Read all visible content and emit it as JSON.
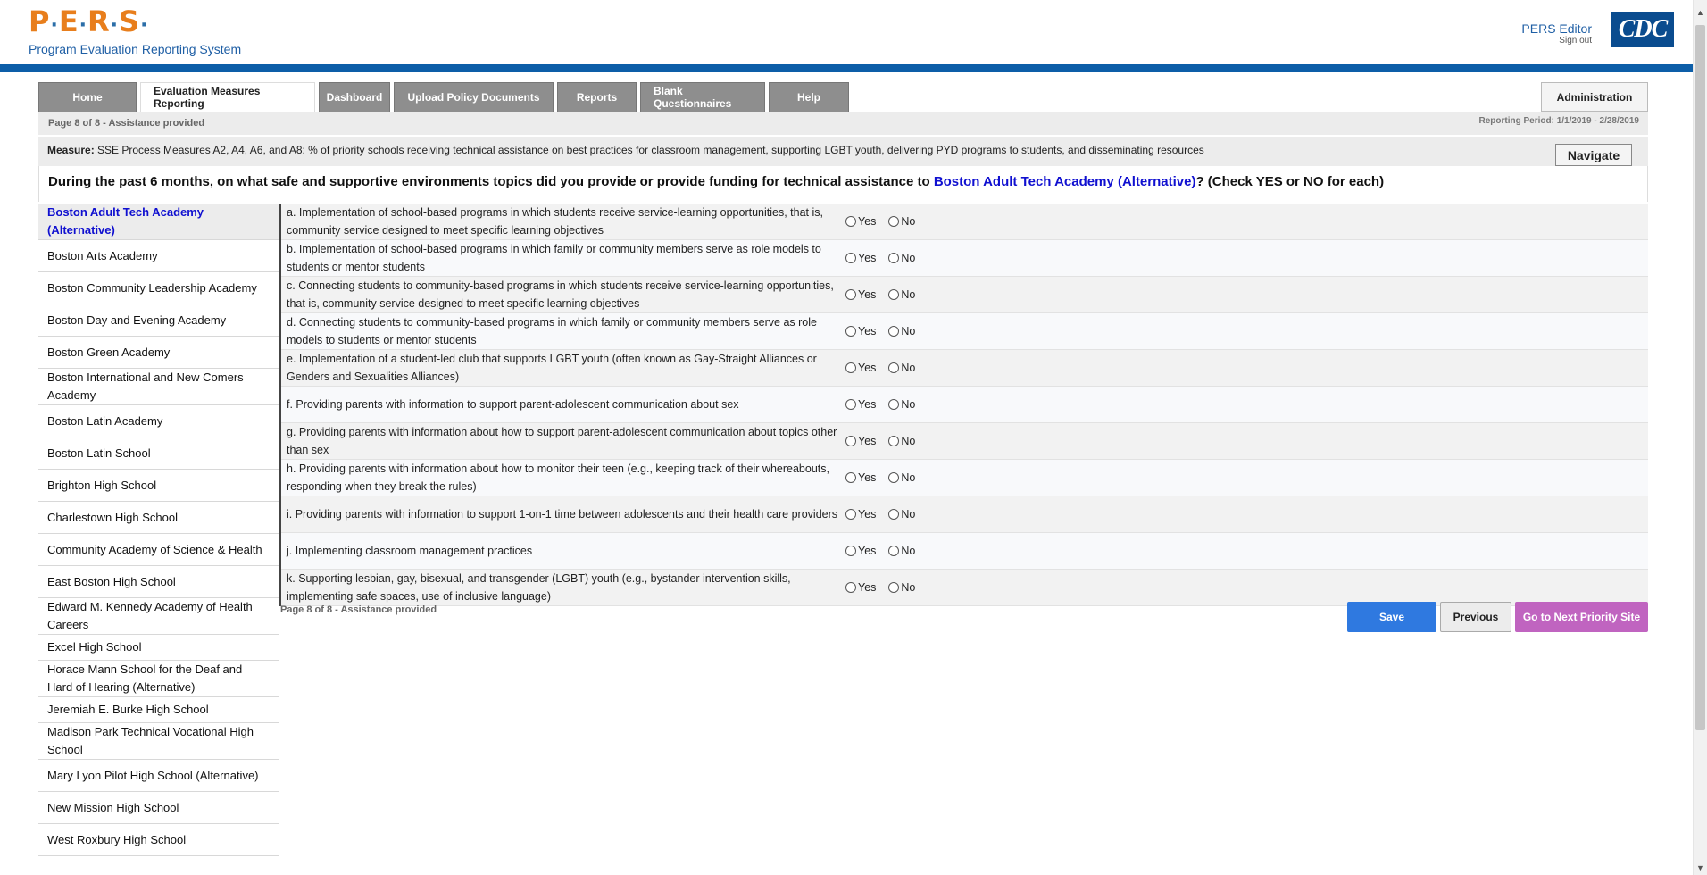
{
  "header": {
    "logo_letters": [
      "P",
      "E",
      "R",
      "S"
    ],
    "logo_dot": "·",
    "subtitle": "Program Evaluation Reporting System",
    "user_name": "PERS Editor",
    "sign_out": "Sign out",
    "cdc_logo": "CDC"
  },
  "tabs": [
    {
      "label": "Home",
      "active": false
    },
    {
      "label": "Evaluation Measures Reporting",
      "active": true
    },
    {
      "label": "Dashboard",
      "active": false
    },
    {
      "label": "Upload Policy Documents",
      "active": false
    },
    {
      "label": "Reports",
      "active": false
    },
    {
      "label": "Blank Questionnaires",
      "active": false
    },
    {
      "label": "Help",
      "active": false
    }
  ],
  "admin_label": "Administration",
  "page_info": "Page 8 of 8 - Assistance provided",
  "reporting_period": "Reporting Period: 1/1/2019 - 2/28/2019",
  "measure": {
    "label": "Measure:",
    "text": "SSE Process Measures A2, A4, A6, and A8: % of priority schools receiving technical assistance on best practices for classroom management, supporting LGBT youth, delivering PYD programs to students, and disseminating resources"
  },
  "navigate_label": "Navigate",
  "question": {
    "prefix": "During the past 6 months, on what safe and supportive environments topics did you provide or provide funding for technical assistance to ",
    "site": "Boston Adult Tech Academy (Alternative)",
    "suffix": "? (Check YES or NO for each)"
  },
  "sidebar": [
    "Boston Adult Tech Academy (Alternative)",
    "Boston Arts Academy",
    "Boston Community Leadership Academy",
    "Boston Day and Evening Academy",
    "Boston Green Academy",
    "Boston International and New Comers Academy",
    "Boston Latin Academy",
    "Boston Latin School",
    "Brighton High School",
    "Charlestown High School",
    "Community Academy of Science & Health",
    "East Boston High School",
    "Edward M. Kennedy Academy of Health Careers",
    "Excel High School",
    "Horace Mann School for the Deaf and Hard of Hearing (Alternative)",
    "Jeremiah E. Burke High School",
    "Madison Park Technical Vocational High School",
    "Mary Lyon Pilot High School (Alternative)",
    "New Mission High School",
    "West Roxbury High School"
  ],
  "sidebar_active_index": 0,
  "option_yes": "Yes",
  "option_no": "No",
  "questions": [
    "a. Implementation of school-based programs in which students receive service-learning opportunities, that is, community service designed to meet specific learning objectives",
    "b. Implementation of school-based programs in which family or community members serve as role models to students or mentor students",
    "c. Connecting students to community-based programs in which students receive service-learning opportunities, that is, community service designed to meet specific learning objectives",
    "d. Connecting students to community-based programs in which family or community members serve as role models to students or mentor students",
    "e. Implementation of a student-led club that supports LGBT youth (often known as Gay-Straight Alliances or Genders and Sexualities Alliances)",
    "f. Providing parents with information to support parent-adolescent communication about sex",
    "g. Providing parents with information about how to support parent-adolescent communication about topics other than sex",
    "h. Providing parents with information about how to monitor their teen (e.g., keeping track of their whereabouts, responding when they break the rules)",
    "i. Providing parents with information to support 1-on-1 time between adolescents and their health care providers",
    "j. Implementing classroom management practices",
    "k. Supporting lesbian, gay, bisexual, and transgender (LGBT) youth (e.g., bystander intervention skills, implementing safe spaces, use of inclusive language)"
  ],
  "buttons": {
    "save": "Save",
    "previous": "Previous",
    "next": "Go to Next Priority Site"
  },
  "colors": {
    "brand_orange": "#e87e1c",
    "brand_blue": "#0d5ea8",
    "link_blue": "#1010d0",
    "save_blue": "#2f79e0",
    "next_purple": "#c064c0"
  }
}
